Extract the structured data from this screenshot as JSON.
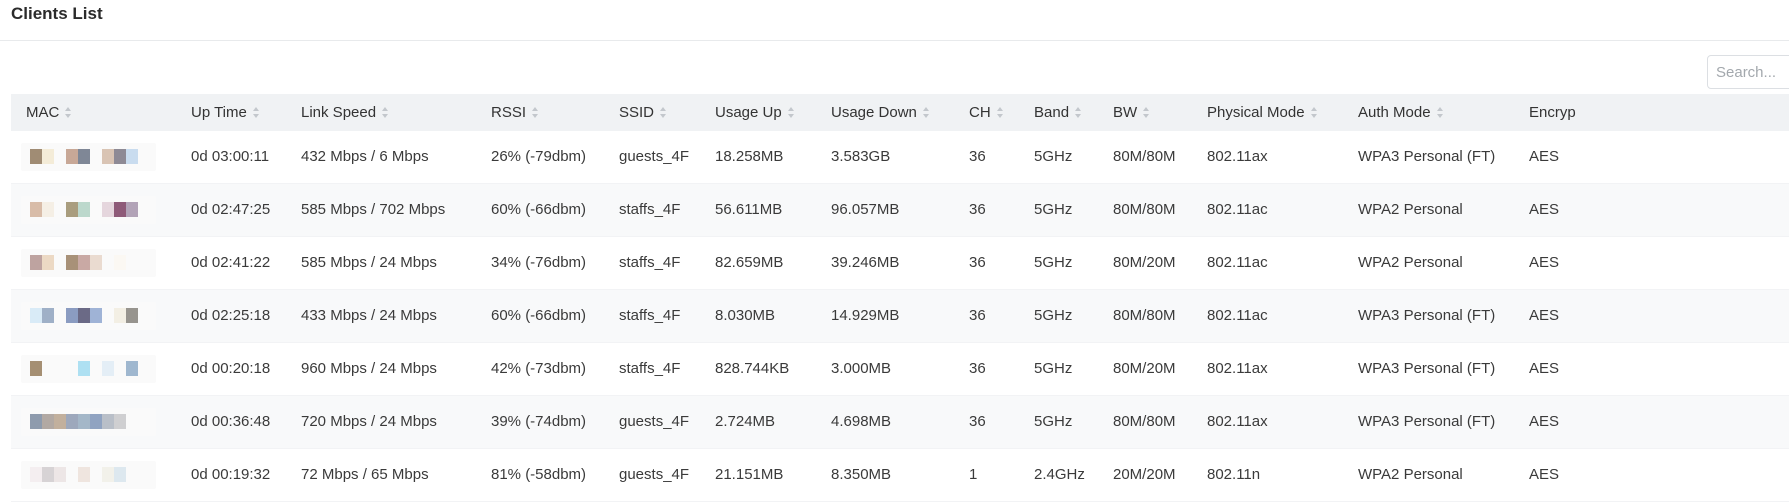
{
  "page": {
    "title": "Clients List"
  },
  "search": {
    "placeholder": "Search..."
  },
  "table": {
    "columns": [
      {
        "key": "mac",
        "label": "MAC"
      },
      {
        "key": "uptime",
        "label": "Up Time"
      },
      {
        "key": "link_speed",
        "label": "Link Speed"
      },
      {
        "key": "rssi",
        "label": "RSSI"
      },
      {
        "key": "ssid",
        "label": "SSID"
      },
      {
        "key": "usage_up",
        "label": "Usage Up"
      },
      {
        "key": "usage_down",
        "label": "Usage Down"
      },
      {
        "key": "ch",
        "label": "CH"
      },
      {
        "key": "band",
        "label": "Band"
      },
      {
        "key": "bw",
        "label": "BW"
      },
      {
        "key": "physical_mode",
        "label": "Physical Mode"
      },
      {
        "key": "auth_mode",
        "label": "Auth Mode"
      },
      {
        "key": "encryption",
        "label": "Encryp"
      }
    ],
    "rows": [
      {
        "uptime": "0d 03:00:11",
        "link_speed": "432 Mbps / 6 Mbps",
        "rssi": "26% (-79dbm)",
        "ssid": "guests_4F",
        "usage_up": "18.258MB",
        "usage_down": "3.583GB",
        "ch": "36",
        "band": "5GHz",
        "bw": "80M/80M",
        "physical_mode": "802.11ax",
        "auth_mode": "WPA3 Personal (FT)",
        "encryption": "AES",
        "mac_colors": [
          "#a08c74",
          "#f4ecd8",
          "",
          "#c8a897",
          "#7f8796",
          "",
          "#d9c4b4",
          "#8e8a95",
          "#c9dcef"
        ]
      },
      {
        "uptime": "0d 02:47:25",
        "link_speed": "585 Mbps / 702 Mbps",
        "rssi": "60% (-66dbm)",
        "ssid": "staffs_4F",
        "usage_up": "56.611MB",
        "usage_down": "96.057MB",
        "ch": "36",
        "band": "5GHz",
        "bw": "80M/80M",
        "physical_mode": "802.11ac",
        "auth_mode": "WPA2 Personal",
        "encryption": "AES",
        "mac_colors": [
          "#d8bca8",
          "#f5efe5",
          "",
          "#a99d7e",
          "#bcd8cc",
          "",
          "#e5d6dd",
          "#8e5a78",
          "#b2a3b7"
        ]
      },
      {
        "uptime": "0d 02:41:22",
        "link_speed": "585 Mbps / 24 Mbps",
        "rssi": "34% (-76dbm)",
        "ssid": "staffs_4F",
        "usage_up": "82.659MB",
        "usage_down": "39.246MB",
        "ch": "36",
        "band": "5GHz",
        "bw": "80M/20M",
        "physical_mode": "802.11ac",
        "auth_mode": "WPA2 Personal",
        "encryption": "AES",
        "mac_colors": [
          "#bea3a0",
          "#ecd9c4",
          "",
          "#a89178",
          "#c9a9a4",
          "#eadbd0",
          "",
          "#fbf8f3",
          ""
        ]
      },
      {
        "uptime": "0d 02:25:18",
        "link_speed": "433 Mbps / 24 Mbps",
        "rssi": "60% (-66dbm)",
        "ssid": "staffs_4F",
        "usage_up": "8.030MB",
        "usage_down": "14.929MB",
        "ch": "36",
        "band": "5GHz",
        "bw": "80M/80M",
        "physical_mode": "802.11ac",
        "auth_mode": "WPA3 Personal (FT)",
        "encryption": "AES",
        "mac_colors": [
          "#d9ebf7",
          "#9fb0c7",
          "",
          "#8b9cc1",
          "#6b6a86",
          "#9fb3d6",
          "",
          "#f3efe4",
          "#97948e"
        ]
      },
      {
        "uptime": "0d 00:20:18",
        "link_speed": "960 Mbps / 24 Mbps",
        "rssi": "42% (-73dbm)",
        "ssid": "staffs_4F",
        "usage_up": "828.744KB",
        "usage_down": "3.000MB",
        "ch": "36",
        "band": "5GHz",
        "bw": "80M/20M",
        "physical_mode": "802.11ax",
        "auth_mode": "WPA3 Personal (FT)",
        "encryption": "AES",
        "mac_colors": [
          "#a58f73",
          "",
          "",
          "",
          "#aee0f2",
          "",
          "#e4eef6",
          "",
          "#9fb7cf"
        ]
      },
      {
        "uptime": "0d 00:36:48",
        "link_speed": "720 Mbps / 24 Mbps",
        "rssi": "39% (-74dbm)",
        "ssid": "guests_4F",
        "usage_up": "2.724MB",
        "usage_down": "4.698MB",
        "ch": "36",
        "band": "5GHz",
        "bw": "80M/80M",
        "physical_mode": "802.11ax",
        "auth_mode": "WPA3 Personal (FT)",
        "encryption": "AES",
        "mac_colors": [
          "#8e9bad",
          "#b2a9a3",
          "#c2b09d",
          "#9da8bc",
          "#a4b7c8",
          "#90a3c1",
          "#b9bfc8",
          "#cfcfd1",
          ""
        ]
      },
      {
        "uptime": "0d 00:19:32",
        "link_speed": "72 Mbps / 65 Mbps",
        "rssi": "81% (-58dbm)",
        "ssid": "guests_4F",
        "usage_up": "21.151MB",
        "usage_down": "8.350MB",
        "ch": "1",
        "band": "2.4GHz",
        "bw": "20M/20M",
        "physical_mode": "802.11n",
        "auth_mode": "WPA2 Personal",
        "encryption": "AES",
        "mac_colors": [
          "#f4eef0",
          "#d7d3d5",
          "#ede6e6",
          "",
          "#efe5df",
          "",
          "#f2f1ea",
          "#dde8ef",
          ""
        ]
      }
    ]
  }
}
